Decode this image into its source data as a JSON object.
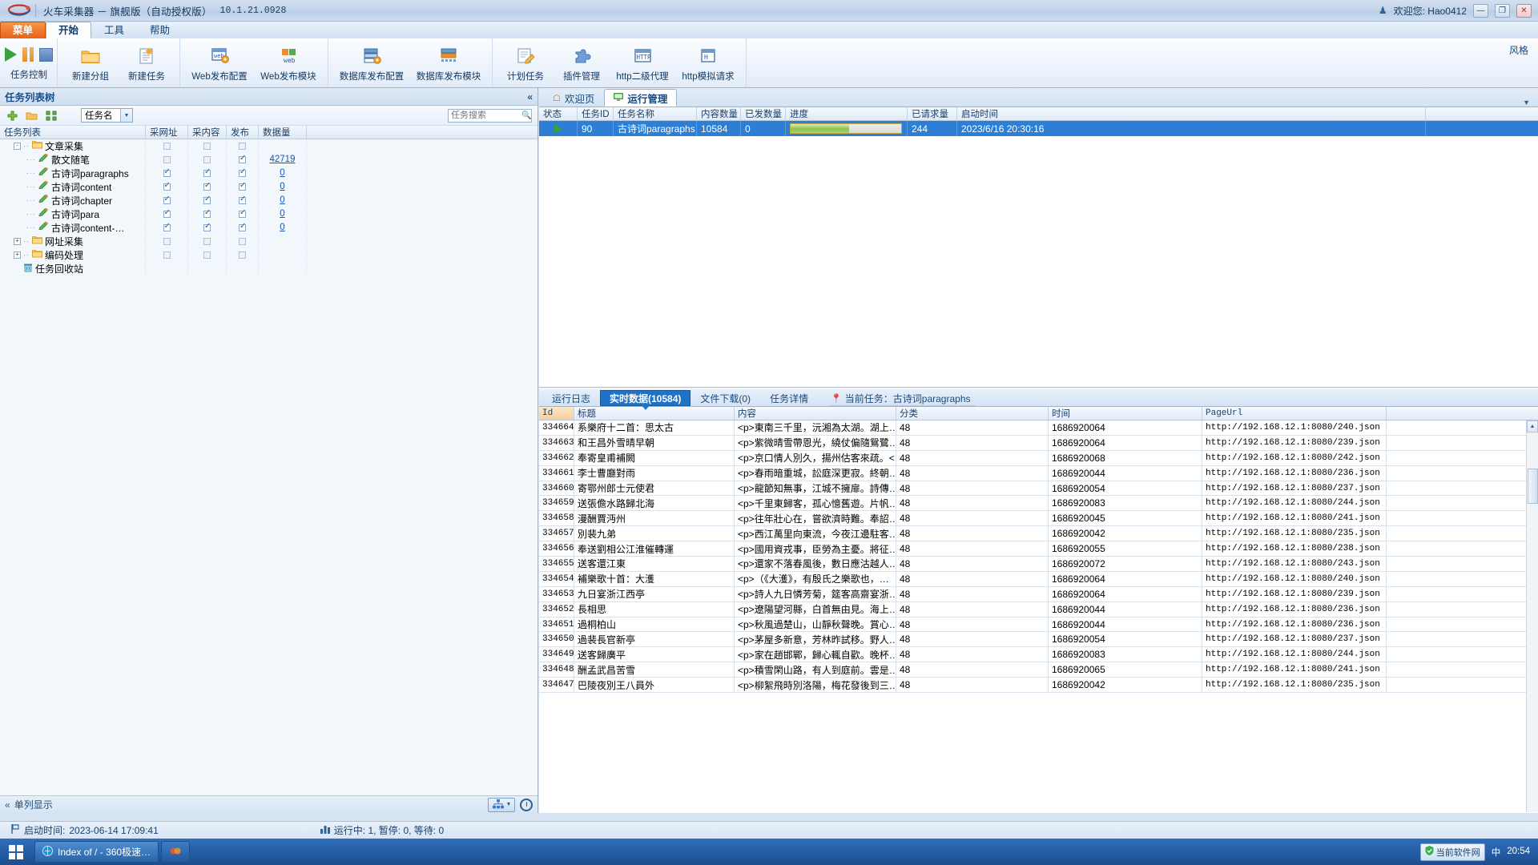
{
  "titlebar": {
    "app_title": "火车采集器 － 旗舰版（自动授权版）",
    "version": "10.1.21.0928",
    "user_greeting": "欢迎您: Hao0412",
    "logo_icon": "train-logo-icon",
    "minimize_icon": "minimize-icon",
    "maximize_icon": "maximize-icon",
    "close_icon": "close-icon",
    "minimize_label": "—",
    "maximize_label": "❐",
    "close_label": "✕"
  },
  "menubar": {
    "tabs": [
      {
        "label": "菜单",
        "style": "orange"
      },
      {
        "label": "开始",
        "style": "active"
      },
      {
        "label": "工具",
        "style": "normal"
      },
      {
        "label": "帮助",
        "style": "normal"
      }
    ]
  },
  "ribbon": {
    "control_group_label": "任务控制",
    "controls": [
      {
        "label": "开始",
        "icon": "play-icon"
      },
      {
        "label": "暂停",
        "icon": "pause-icon"
      },
      {
        "label": "停止",
        "icon": "stop-icon"
      }
    ],
    "items": [
      {
        "label": "新建分组",
        "icon": "new-folder-icon"
      },
      {
        "label": "新建任务",
        "icon": "new-task-icon"
      },
      {
        "label": "Web发布配置",
        "icon": "web-publish-config-icon"
      },
      {
        "label": "Web发布模块",
        "icon": "web-publish-module-icon"
      },
      {
        "label": "数据库发布配置",
        "icon": "db-publish-config-icon"
      },
      {
        "label": "数据库发布模块",
        "icon": "db-publish-module-icon"
      },
      {
        "label": "计划任务",
        "icon": "scheduled-task-icon"
      },
      {
        "label": "插件管理",
        "icon": "plugin-manager-icon"
      },
      {
        "label": "http二级代理",
        "icon": "http-proxy-icon"
      },
      {
        "label": "http模拟请求",
        "icon": "http-request-icon"
      }
    ],
    "style_label": "风格"
  },
  "left_panel": {
    "header_title": "任务列表树",
    "collapse_label": "«",
    "toolbar": {
      "add_icon": "add-plus-icon",
      "folder_icon": "open-folder-icon",
      "expand_icon": "expand-all-icon",
      "filter_value": "任务名",
      "dropdown_icon": "chevron-down-icon",
      "search_placeholder": "任务搜索",
      "search_value": "",
      "search_icon": "search-icon"
    },
    "columns": [
      "任务列表",
      "采网址",
      "采内容",
      "发布",
      "数据量"
    ],
    "rows": [
      {
        "label": "文章采集",
        "type": "group",
        "depth": 0,
        "expander": "-",
        "icon": "folder-icon",
        "url": "off",
        "content": "off",
        "publish": "off",
        "data": ""
      },
      {
        "label": "散文随笔",
        "type": "task",
        "depth": 1,
        "icon": "task-pencil-icon",
        "url": "off",
        "content": "off",
        "publish": "on",
        "data": "42719"
      },
      {
        "label": "古诗词paragraphs",
        "type": "task",
        "depth": 1,
        "icon": "task-pencil-icon",
        "url": "on",
        "content": "on",
        "publish": "on",
        "data": "0"
      },
      {
        "label": "古诗词content",
        "type": "task",
        "depth": 1,
        "icon": "task-pencil-icon",
        "url": "on",
        "content": "on",
        "publish": "on",
        "data": "0"
      },
      {
        "label": "古诗词chapter",
        "type": "task",
        "depth": 1,
        "icon": "task-pencil-icon",
        "url": "on",
        "content": "on",
        "publish": "on",
        "data": "0"
      },
      {
        "label": "古诗词para",
        "type": "task",
        "depth": 1,
        "icon": "task-pencil-icon",
        "url": "on",
        "content": "on",
        "publish": "on",
        "data": "0"
      },
      {
        "label": "古诗词content-…",
        "type": "task",
        "depth": 1,
        "icon": "task-pencil-icon",
        "url": "on",
        "content": "on",
        "publish": "on",
        "data": "0"
      },
      {
        "label": "网址采集",
        "type": "group",
        "depth": 0,
        "expander": "+",
        "icon": "folder-icon",
        "url": "off",
        "content": "off",
        "publish": "off",
        "data": ""
      },
      {
        "label": "编码处理",
        "type": "group",
        "depth": 0,
        "expander": "+",
        "icon": "folder-icon",
        "url": "off",
        "content": "off",
        "publish": "off",
        "data": ""
      },
      {
        "label": "任务回收站",
        "type": "trash",
        "depth": 0,
        "icon": "trash-icon",
        "url": "",
        "content": "",
        "publish": "",
        "data": ""
      }
    ],
    "footer": {
      "collapse_label": "«",
      "display_mode": "单列显示",
      "net_icon": "network-tree-icon",
      "net_dropdown_icon": "chevron-down-icon",
      "clock_icon": "clock-icon"
    }
  },
  "right_panel": {
    "tabs": [
      {
        "label": "欢迎页",
        "icon": "home-icon",
        "active": false
      },
      {
        "label": "运行管理",
        "icon": "monitor-icon",
        "active": true
      }
    ],
    "collapse_icon": "chevron-down-icon",
    "run_grid": {
      "columns": [
        "状态",
        "任务ID",
        "任务名称",
        "内容数量",
        "已发数量",
        "进度",
        "已请求量",
        "启动时间"
      ],
      "rows": [
        {
          "status_icon": "running-play-icon",
          "task_id": "90",
          "task_name": "古诗词paragraphs",
          "content_count": "10584",
          "published_count": "0",
          "progress_percent": 52,
          "request_count": "244",
          "start_time": "2023/6/16 20:30:16"
        }
      ]
    }
  },
  "bottom_panel": {
    "tabs": [
      {
        "label": "运行日志",
        "active": false
      },
      {
        "label": "实时数据(10584)",
        "active": true
      },
      {
        "label": "文件下载(0)",
        "active": false
      },
      {
        "label": "任务详情",
        "active": false
      }
    ],
    "current_task_label": "当前任务：古诗词paragraphs",
    "pin_icon": "location-pin-icon",
    "columns": [
      "Id",
      "标题",
      "内容",
      "分类",
      "时间",
      "PageUrl"
    ],
    "rows": [
      {
        "id": "334664",
        "title": "系樂府十二首：思太古",
        "content": "<p>東南三千里，沅湘為太湖。湖上…",
        "category": "48",
        "time": "1686920064",
        "page_url": "http://192.168.12.1:8080/240.json"
      },
      {
        "id": "334663",
        "title": "和王昌外雪晴早朝",
        "content": "<p>紫微晴雪帶恩光，繞仗偏隨鴛鷺…",
        "category": "48",
        "time": "1686920064",
        "page_url": "http://192.168.12.1:8080/239.json"
      },
      {
        "id": "334662",
        "title": "奉寄皇甫補闕",
        "content": "<p>京口情人別久，揚州估客來疏。<…",
        "category": "48",
        "time": "1686920068",
        "page_url": "http://192.168.12.1:8080/242.json"
      },
      {
        "id": "334661",
        "title": "李士曹廳對雨",
        "content": "<p>春雨暗重城，訟庭深更寂。終朝…",
        "category": "48",
        "time": "1686920044",
        "page_url": "http://192.168.12.1:8080/236.json"
      },
      {
        "id": "334660",
        "title": "寄鄂州郎士元使君",
        "content": "<p>龍節知無事，江城不擁扉。詩傳…",
        "category": "48",
        "time": "1686920054",
        "page_url": "http://192.168.12.1:8080/237.json"
      },
      {
        "id": "334659",
        "title": "送張儋水路歸北海",
        "content": "<p>千里東歸客，孤心憶舊遊。片帆…",
        "category": "48",
        "time": "1686920083",
        "page_url": "http://192.168.12.1:8080/244.json"
      },
      {
        "id": "334658",
        "title": "漫酬賈沔州",
        "content": "<p>往年壯心在，嘗欲濟時難。奉詔…",
        "category": "48",
        "time": "1686920045",
        "page_url": "http://192.168.12.1:8080/241.json"
      },
      {
        "id": "334657",
        "title": "別裴九弟",
        "content": "<p>西江萬里向東流，今夜江邊駐客…",
        "category": "48",
        "time": "1686920042",
        "page_url": "http://192.168.12.1:8080/235.json"
      },
      {
        "id": "334656",
        "title": "奉送劉相公江淮催轉運",
        "content": "<p>國用資戎事，臣勞為主憂。將征…",
        "category": "48",
        "time": "1686920055",
        "page_url": "http://192.168.12.1:8080/238.json"
      },
      {
        "id": "334655",
        "title": "送客還江東",
        "content": "<p>還家不落春風後，數日應沽越人…",
        "category": "48",
        "time": "1686920072",
        "page_url": "http://192.168.12.1:8080/243.json"
      },
      {
        "id": "334654",
        "title": "補樂歌十首：大濩",
        "content": "<p>（《大濩》，有殷氏之樂歌也，…",
        "category": "48",
        "time": "1686920064",
        "page_url": "http://192.168.12.1:8080/240.json"
      },
      {
        "id": "334653",
        "title": "九日宴浙江西亭",
        "content": "<p>詩人九日憐芳菊，筵客高齋宴浙…",
        "category": "48",
        "time": "1686920064",
        "page_url": "http://192.168.12.1:8080/239.json"
      },
      {
        "id": "334652",
        "title": "長相思",
        "content": "<p>遼陽望河縣，白首無由見。海上…",
        "category": "48",
        "time": "1686920044",
        "page_url": "http://192.168.12.1:8080/236.json"
      },
      {
        "id": "334651",
        "title": "過桐柏山",
        "content": "<p>秋風過楚山，山靜秋聲晚。賞心…",
        "category": "48",
        "time": "1686920044",
        "page_url": "http://192.168.12.1:8080/236.json"
      },
      {
        "id": "334650",
        "title": "過裴長官新亭",
        "content": "<p>茅屋多新意，芳林昨試移。野人…",
        "category": "48",
        "time": "1686920054",
        "page_url": "http://192.168.12.1:8080/237.json"
      },
      {
        "id": "334649",
        "title": "送客歸廣平",
        "content": "<p>家在趙邯鄲，歸心輒自歡。晚杯…",
        "category": "48",
        "time": "1686920083",
        "page_url": "http://192.168.12.1:8080/244.json"
      },
      {
        "id": "334648",
        "title": "酬孟武昌苦雪",
        "content": "<p>積雪閑山路，有人到庭前。雲是…",
        "category": "48",
        "time": "1686920065",
        "page_url": "http://192.168.12.1:8080/241.json"
      },
      {
        "id": "334647",
        "title": "巴陵夜別王八員外",
        "content": "<p>柳絮飛時別洛陽，梅花發後到三…",
        "category": "48",
        "time": "1686920042",
        "page_url": "http://192.168.12.1:8080/235.json"
      }
    ],
    "scroll_up_icon": "scroll-up-icon",
    "scroll_down_icon": "scroll-down-icon"
  },
  "statusbar": {
    "start_time_icon": "flag-icon",
    "start_time_label": "启动时间:",
    "start_time_value": "2023-06-14 17:09:41",
    "stats_icon": "chart-bars-icon",
    "stats_text": "运行中: 1,  暂停: 0,  等待: 0"
  },
  "taskbar": {
    "start_icon": "windows-start-icon",
    "apps": [
      {
        "label": "Index of / - 360极速…",
        "icon": "browser-icon"
      },
      {
        "label": "",
        "icon": "app-icon"
      }
    ],
    "tray_text": "当前软件网",
    "tray_icon": "shield-icon",
    "time": "20:54",
    "lang_icon": "ime-icon",
    "notify_icon": "notification-icon"
  }
}
